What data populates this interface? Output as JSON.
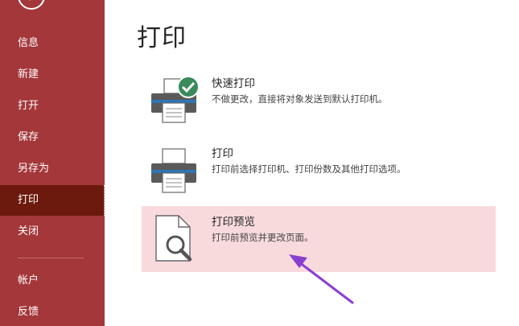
{
  "sidebar": {
    "items": [
      {
        "id": "info",
        "label": "信息"
      },
      {
        "id": "new",
        "label": "新建"
      },
      {
        "id": "open",
        "label": "打开"
      },
      {
        "id": "save",
        "label": "保存"
      },
      {
        "id": "saveas",
        "label": "另存为"
      },
      {
        "id": "print",
        "label": "打印",
        "active": true
      },
      {
        "id": "close",
        "label": "关闭"
      },
      {
        "id": "account",
        "label": "帐户"
      },
      {
        "id": "feedback",
        "label": "反馈"
      }
    ],
    "back_icon": "back-arrow-icon"
  },
  "main": {
    "title": "打印",
    "options": [
      {
        "title": "快速打印",
        "description": "不做更改，直接将对象发送到默认打印机。",
        "icon": "quick-print-icon"
      },
      {
        "title": "打印",
        "description": "打印前选择打印机、打印份数及其他打印选项。",
        "icon": "printer-icon"
      },
      {
        "title": "打印预览",
        "description": "打印前预览并更改页面。",
        "icon": "print-preview-icon"
      }
    ]
  },
  "colors": {
    "sidebar_bg": "#a4373a",
    "sidebar_active": "#6b1a0d",
    "highlight_bg": "#f8dadd",
    "check_green": "#3b8a5c",
    "annotation_arrow": "#8a3fd1"
  }
}
